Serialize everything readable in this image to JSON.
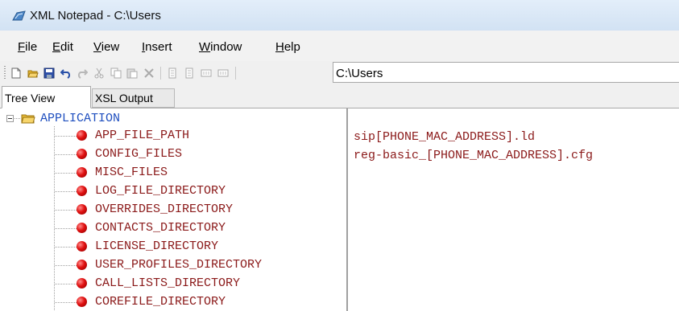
{
  "window": {
    "title": "XML Notepad - C:\\Users"
  },
  "menu": [
    {
      "prefix": "",
      "key": "F",
      "rest": "ile"
    },
    {
      "prefix": "",
      "key": "E",
      "rest": "dit"
    },
    {
      "prefix": "",
      "key": "V",
      "rest": "iew"
    },
    {
      "prefix": "",
      "key": "I",
      "rest": "nsert"
    },
    {
      "prefix": "",
      "key": "W",
      "rest": "indow"
    },
    {
      "prefix": "",
      "key": "H",
      "rest": "elp"
    }
  ],
  "toolbar": {
    "icons": [
      "new-icon",
      "open-icon",
      "save-icon",
      "undo-icon",
      "redo-icon",
      "cut-icon",
      "copy-icon",
      "paste-icon",
      "delete-icon",
      "nudge-up-icon",
      "nudge-down-icon",
      "nudge-left-icon",
      "nudge-right-icon"
    ],
    "path_value": "C:\\Users"
  },
  "tabs": {
    "tree_view": "Tree View",
    "xsl_output": "XSL Output"
  },
  "tree": {
    "root": "APPLICATION",
    "children": [
      "APP_FILE_PATH",
      "CONFIG_FILES",
      "MISC_FILES",
      "LOG_FILE_DIRECTORY",
      "OVERRIDES_DIRECTORY",
      "CONTACTS_DIRECTORY",
      "LICENSE_DIRECTORY",
      "USER_PROFILES_DIRECTORY",
      "CALL_LISTS_DIRECTORY",
      "COREFILE_DIRECTORY"
    ]
  },
  "values": [
    "",
    "sip[PHONE_MAC_ADDRESS].ld",
    "reg-basic_[PHONE_MAC_ADDRESS].cfg"
  ],
  "colors": {
    "element_name": "#8b1a1a",
    "root_name": "#1f4fbf",
    "node_bullet": "#e01010"
  }
}
